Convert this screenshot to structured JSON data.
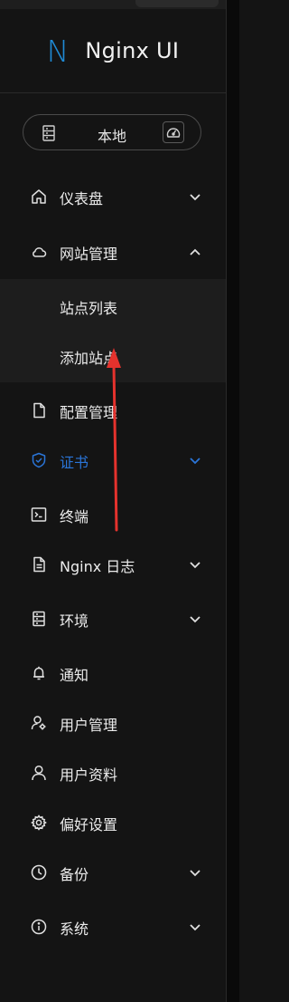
{
  "app": {
    "logo_letter": "N",
    "title": "Nginx UI"
  },
  "environment": {
    "label": "本地"
  },
  "menu": [
    {
      "id": "dashboard",
      "label": "仪表盘",
      "icon": "home-icon",
      "chevron": "down"
    },
    {
      "id": "sites",
      "label": "网站管理",
      "icon": "cloud-icon",
      "chevron": "up",
      "children": [
        "站点列表",
        "添加站点"
      ]
    },
    {
      "id": "config",
      "label": "配置管理",
      "icon": "file-icon"
    },
    {
      "id": "cert",
      "label": "证书",
      "icon": "shield-icon",
      "chevron": "down",
      "active": true
    },
    {
      "id": "terminal",
      "label": "终端",
      "icon": "terminal-icon"
    },
    {
      "id": "logs",
      "label": "Nginx 日志",
      "icon": "file-text-icon",
      "chevron": "down"
    },
    {
      "id": "env",
      "label": "环境",
      "icon": "server-icon",
      "chevron": "down"
    },
    {
      "id": "notify",
      "label": "通知",
      "icon": "bell-icon"
    },
    {
      "id": "users",
      "label": "用户管理",
      "icon": "user-gear-icon"
    },
    {
      "id": "profile",
      "label": "用户资料",
      "icon": "user-icon"
    },
    {
      "id": "prefs",
      "label": "偏好设置",
      "icon": "gear-icon"
    },
    {
      "id": "backup",
      "label": "备份",
      "icon": "clock-icon",
      "chevron": "down"
    },
    {
      "id": "system",
      "label": "系统",
      "icon": "info-icon",
      "chevron": "down"
    }
  ],
  "colors": {
    "accent": "#2a75d8",
    "logo": "#1f8bd6",
    "annotation_arrow": "#e5322d",
    "background": "#141414"
  }
}
